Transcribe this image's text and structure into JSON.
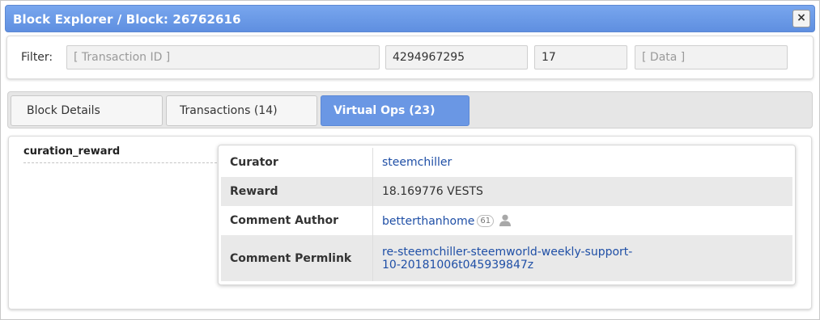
{
  "window": {
    "title": "Block Explorer / Block: 26762616",
    "close_label": "×"
  },
  "filter": {
    "label": "Filter:",
    "transaction_id": {
      "value": "",
      "placeholder": "[ Transaction ID ]"
    },
    "field2": {
      "value": "4294967295"
    },
    "field3": {
      "value": "17"
    },
    "data": {
      "value": "",
      "placeholder": "[ Data ]"
    }
  },
  "tabs": [
    {
      "label": "Block Details",
      "active": false
    },
    {
      "label": "Transactions (14)",
      "active": false
    },
    {
      "label": "Virtual Ops (23)",
      "active": true
    }
  ],
  "operation": {
    "name": "curation_reward",
    "details": {
      "curator_label": "Curator",
      "curator_value": "steemchiller",
      "reward_label": "Reward",
      "reward_value": "18.169776 VESTS",
      "author_label": "Comment Author",
      "author_value": "betterthanhome",
      "author_reputation": "61",
      "permlink_label": "Comment Permlink",
      "permlink_line1": "re-steemchiller-steemworld-weekly-support-",
      "permlink_line2": "10-20181006t045939847z"
    }
  },
  "icons": {
    "close": "close-icon",
    "author_profile": "user-icon"
  },
  "colors": {
    "title_bar": "#6a97e4",
    "active_tab": "#6a97e4",
    "link": "#1f4fa6"
  }
}
